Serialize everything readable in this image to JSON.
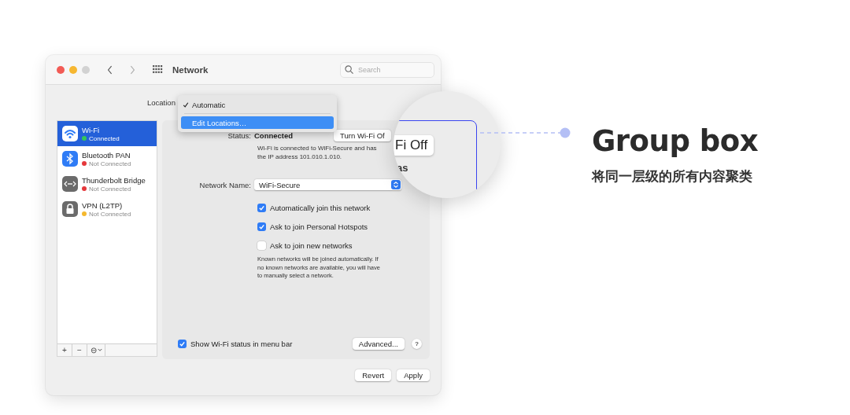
{
  "window": {
    "title": "Network",
    "search": {
      "placeholder": "Search"
    }
  },
  "location": {
    "label": "Location",
    "menu": [
      {
        "label": "Automatic",
        "checked": true,
        "selected": false
      },
      {
        "label": "Edit Locations…",
        "checked": false,
        "selected": true
      }
    ]
  },
  "sidebar": {
    "items": [
      {
        "name": "Wi-Fi",
        "status": "Connected",
        "color": "#34c759",
        "kind": "wifi",
        "selected": true
      },
      {
        "name": "Bluetooth PAN",
        "status": "Not Connected",
        "color": "#e5383b",
        "kind": "bluetooth",
        "selected": false
      },
      {
        "name": "Thunderbolt Bridge",
        "status": "Not Connected",
        "color": "#e5383b",
        "kind": "bridge",
        "selected": false
      },
      {
        "name": "VPN (L2TP)",
        "status": "Not Connected",
        "color": "#f5b82e",
        "kind": "lock",
        "selected": false
      }
    ],
    "toolbar": [
      "+",
      "−",
      "⊖"
    ]
  },
  "panel": {
    "status_label": "Status:",
    "status_value": "Connected",
    "turn_off_button": "Turn Wi-Fi Of",
    "description": "Wi-Fi is connected to WiFi-Secure and has\nthe IP address 101.010.1.010.",
    "network_name_label": "Network Name:",
    "network_name": "WiFi-Secure",
    "options": [
      {
        "label": "Automatically join this network",
        "checked": true
      },
      {
        "label": "Ask to join Personal Hotspots",
        "checked": true
      },
      {
        "label": "Ask to join new networks",
        "checked": false
      }
    ],
    "note": "Known networks will be joined automatically. If\nno known networks are available, you will have\nto manually select a network.",
    "show_status": {
      "label": "Show Wi-Fi status in menu bar",
      "checked": true
    },
    "advanced_button": "Advanced...",
    "help_button": "?"
  },
  "buttons": [
    "Revert",
    "Apply"
  ],
  "magnifier": {
    "button": "Fi Off",
    "text": "as"
  },
  "annotation": {
    "title": "Group box",
    "subtitle": "将同一层级的所有内容聚类"
  }
}
